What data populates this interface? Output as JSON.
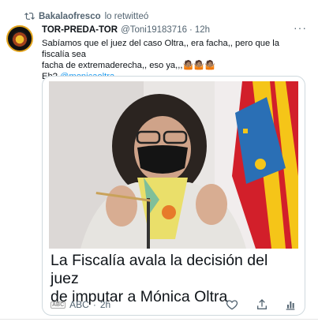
{
  "retweet": {
    "user": "Bakalaofresco",
    "suffix": "lo retwitteó"
  },
  "tweet": {
    "display_name": "TOR-PREDA-TOR",
    "handle": "@Toni19183716",
    "dot": "·",
    "time": "12h",
    "more": "···",
    "text_line1": "Sabíamos que el juez del caso Oltra,, era facha,, pero que la fiscalía sea",
    "text_line2": "facha de extremaderecha,, eso ya,,,🤷🏽🤷🏽🤷🏽",
    "text_line3_prefix": "Eh? ",
    "mention": "@monicaoltra"
  },
  "card": {
    "title_line1": "La Fiscalía avala la decisión del juez",
    "title_line2": "de imputar a Mónica Oltra",
    "source": "ABC",
    "source_logo": "ABC",
    "age": "2h"
  },
  "icons": [
    "retweet-icon",
    "more-icon",
    "like-icon",
    "share-icon",
    "stats-icon"
  ],
  "colors": {
    "link": "#1d9bf0",
    "secondary": "#536471",
    "border": "#cfd9de"
  }
}
